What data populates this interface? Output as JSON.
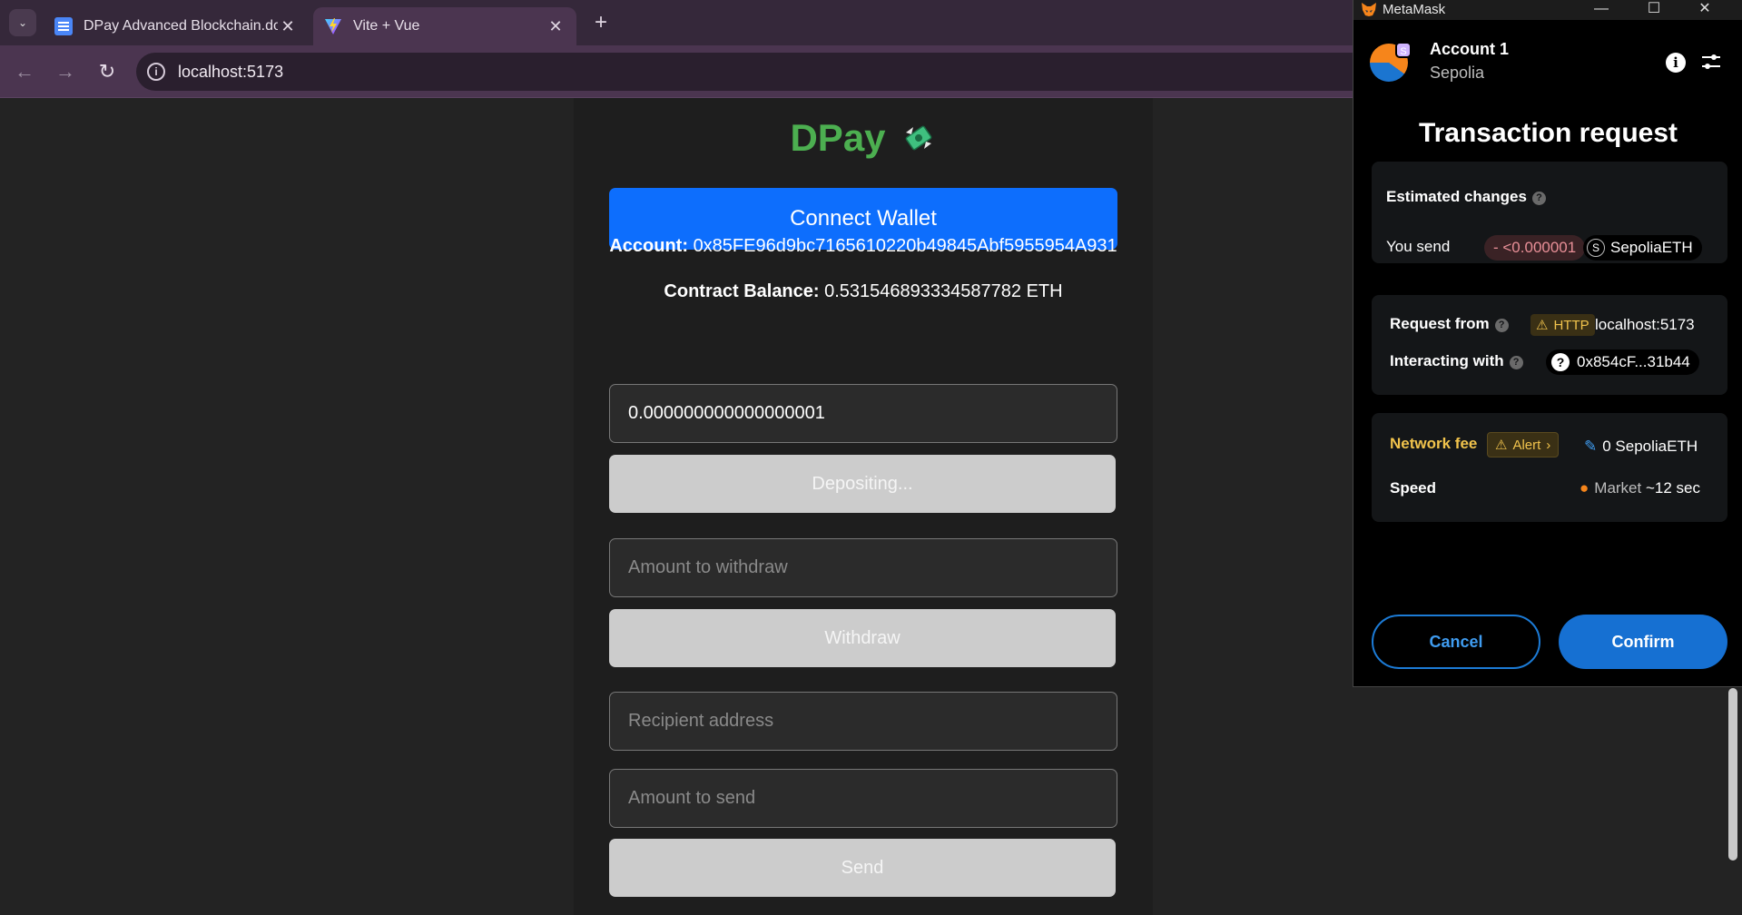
{
  "browser": {
    "tabs": [
      {
        "title": "DPay Advanced Blockchain.docx",
        "close": "✕"
      },
      {
        "title": "Vite + Vue",
        "close": "✕"
      }
    ],
    "tab_menu_glyph": "⌄",
    "new_tab": "+",
    "nav": {
      "back": "←",
      "forward": "→",
      "reload": "↻"
    },
    "url": "localhost:5173"
  },
  "app": {
    "brand": "DPay",
    "connect_label": "Connect Wallet",
    "account_label": "Account:",
    "account_value": "0x85FE96d9bc7165610220b49845Abf5955954A931",
    "balance_label": "Contract Balance:",
    "balance_value": "0.531546893334587782 ETH",
    "deposit_value": "0.000000000000000001",
    "depositing_label": "Depositing...",
    "withdraw_placeholder": "Amount to withdraw",
    "withdraw_label": "Withdraw",
    "recipient_placeholder": "Recipient address",
    "amount_send_placeholder": "Amount to send",
    "send_label": "Send"
  },
  "metamask": {
    "window_title": "MetaMask",
    "controls": {
      "minimize": "—",
      "maximize": "☐",
      "close": "✕"
    },
    "account_name": "Account 1",
    "account_badge": "S",
    "network": "Sepolia",
    "info_glyph": "i",
    "heading": "Transaction request",
    "estimated_changes_label": "Estimated changes",
    "you_send_label": "You send",
    "send_amount": "- <0.000001",
    "token_glyph": "S",
    "token": "SepoliaETH",
    "request_from_label": "Request from",
    "http_tag": "HTTP",
    "request_origin": "localhost:5173",
    "interacting_label": "Interacting with",
    "contract_address": "0x854cF...31b44",
    "network_fee_label": "Network fee",
    "alert_label": "Alert",
    "fee_value": "0 SepoliaETH",
    "speed_label": "Speed",
    "speed_value": "Market",
    "speed_time": "~12 sec",
    "cancel_label": "Cancel",
    "confirm_label": "Confirm"
  },
  "colors": {
    "brand_green": "#4caf50",
    "primary_blue": "#0d6efd",
    "metamask_blue": "#1670d2",
    "warning_yellow": "#f1c34c"
  }
}
